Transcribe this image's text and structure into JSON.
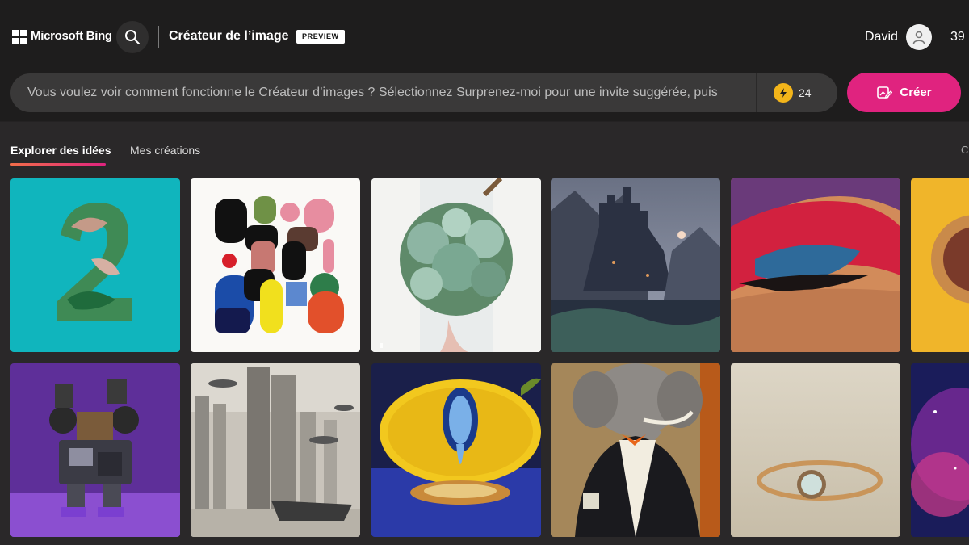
{
  "header": {
    "brand": "Microsoft Bing",
    "search_icon": "search-icon",
    "app_title": "Créateur de l’image",
    "badge": "PREVIEW",
    "user_name": "David",
    "avatar_icon": "person-icon",
    "rewards": "39"
  },
  "prompt": {
    "placeholder": "Vous voulez voir comment fonctionne le Créateur d’images ? Sélectionnez Surprenez-moi pour une invite suggérée, puis",
    "boost_icon": "boost-icon",
    "boost_count": "24"
  },
  "create_button": {
    "label": "Créer",
    "icon": "create-icon"
  },
  "tabs": [
    {
      "label": "Explorer des idées",
      "active": true
    },
    {
      "label": "Mes créations",
      "active": false
    }
  ],
  "tabs_edge_text": "C",
  "colors": {
    "accent": "#e0237f",
    "boost": "#f3b51a",
    "background": "#1e1d1d"
  },
  "gallery": [
    {
      "name": "number-two-leaves"
    },
    {
      "name": "abstract-shapes"
    },
    {
      "name": "succulent-bouquet"
    },
    {
      "name": "dark-castle-mountains"
    },
    {
      "name": "colorful-eyeshadow"
    },
    {
      "name": "astronaut-yellow"
    },
    {
      "name": "purple-robot"
    },
    {
      "name": "futuristic-city"
    },
    {
      "name": "melting-lemon"
    },
    {
      "name": "elephant-tuxedo"
    },
    {
      "name": "gold-ring"
    },
    {
      "name": "nebula-space"
    }
  ]
}
